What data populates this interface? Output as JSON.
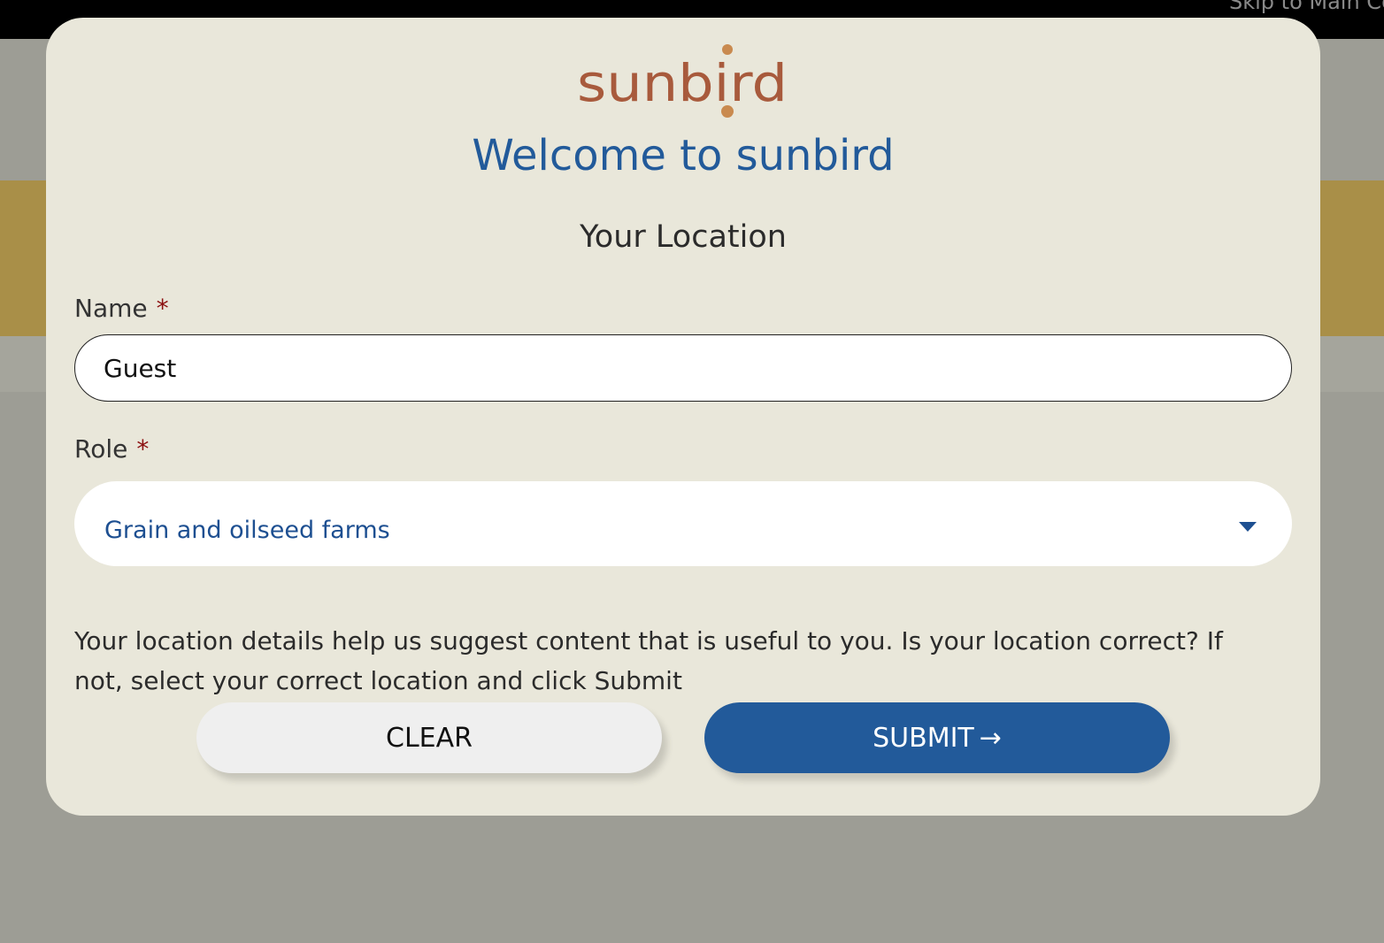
{
  "background": {
    "skip_link": "Skip to Main Co"
  },
  "modal": {
    "logo_text": "sunbird",
    "title": "Welcome to sunbird",
    "heading": "Your Location",
    "name_field": {
      "label": "Name",
      "required_marker": "*",
      "value": "Guest"
    },
    "role_field": {
      "label": "Role",
      "required_marker": "*",
      "selected": "Grain and oilseed farms"
    },
    "info_text": "Your location details help us suggest content that is useful to you. Is your location correct? If not, select your correct location and click Submit",
    "buttons": {
      "clear": "CLEAR",
      "submit": "SUBMIT",
      "submit_icon": "→"
    }
  },
  "colors": {
    "accent_blue": "#225a9a",
    "logo_brown": "#a85a3c",
    "logo_dot": "#c98a4f",
    "modal_bg": "#e9e7da",
    "required_red": "#8b1010"
  }
}
